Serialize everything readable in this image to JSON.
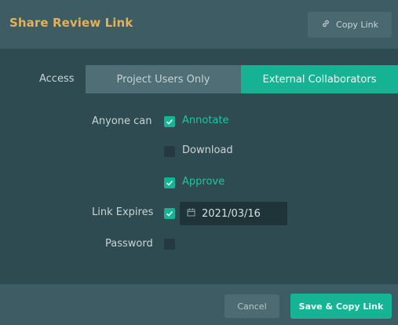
{
  "header": {
    "title": "Share Review Link",
    "copy_link_label": "Copy Link"
  },
  "access": {
    "label": "Access",
    "options": [
      "Project Users Only",
      "External Collaborators"
    ],
    "selected": "External Collaborators"
  },
  "permissions": {
    "label": "Anyone can",
    "items": [
      {
        "label": "Annotate",
        "checked": true
      },
      {
        "label": "Download",
        "checked": false
      },
      {
        "label": "Approve",
        "checked": true
      }
    ]
  },
  "expiry": {
    "label": "Link Expires",
    "enabled": true,
    "date": "2021/03/16"
  },
  "password": {
    "label": "Password",
    "enabled": false
  },
  "footer": {
    "cancel_label": "Cancel",
    "save_label": "Save & Copy Link"
  },
  "colors": {
    "accent": "#14b494",
    "title": "#e0b25a",
    "background": "#2f4b52"
  }
}
